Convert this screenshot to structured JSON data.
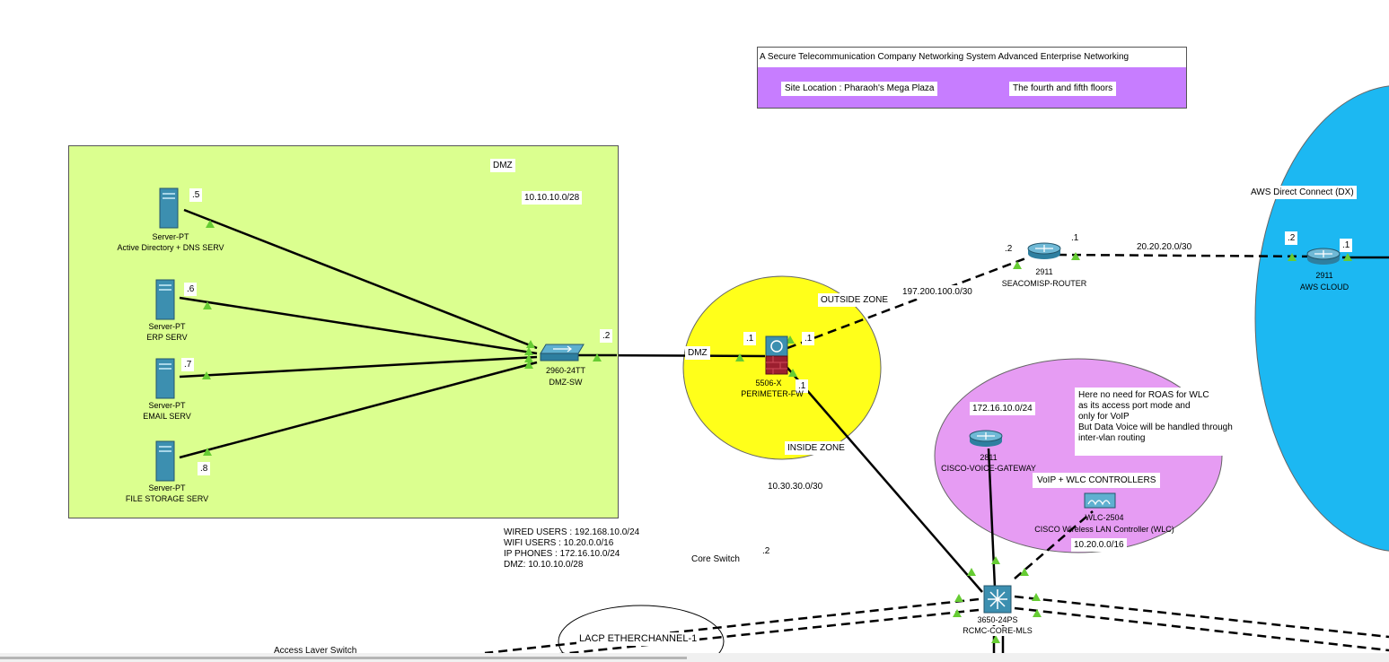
{
  "title": {
    "main": "A Secure Telecommunication Company Networking System  Advanced Enterprise Networking",
    "site_location": "Site Location : Pharaoh's Mega Plaza",
    "floors": "The fourth and fifth floors"
  },
  "dmz_zone": {
    "label": "DMZ",
    "subnet": "10.10.10.0/28",
    "servers": [
      {
        "model": "Server-PT",
        "name": "Active Directory + DNS SERV",
        "ip": ".5"
      },
      {
        "model": "Server-PT",
        "name": "ERP SERV",
        "ip": ".6"
      },
      {
        "model": "Server-PT",
        "name": "EMAIL SERV",
        "ip": ".7"
      },
      {
        "model": "Server-PT",
        "name": "FILE STORAGE SERV",
        "ip": ".8"
      }
    ],
    "switch": {
      "model": "2960-24TT",
      "name": "DMZ-SW",
      "ip": ".2"
    }
  },
  "firewall": {
    "model": "5506-X",
    "name": "PERIMETER-FW",
    "outside_zone": "OUTSIDE ZONE",
    "inside_zone": "INSIDE ZONE",
    "dmz_link_label": "DMZ",
    "ip_dmz": ".1",
    "ip_outside": ".1",
    "ip_inside": ".1"
  },
  "isp": {
    "model": "2911",
    "name": "SEACOMISP-ROUTER",
    "link_subnet": "197.200.100.0/30",
    "ip_left": ".2",
    "ip_right": ".1",
    "uplink_subnet": "20.20.20.0/30"
  },
  "aws": {
    "label": "AWS Direct Connect (DX)",
    "model": "2911",
    "name": "AWS CLOUD",
    "ip_left": ".2",
    "ip_right": ".1"
  },
  "voip_zone": {
    "gateway_subnet": "172.16.10.0/24",
    "gateway_model": "2811",
    "gateway_name": "CISCO-VOICE-GATEWAY",
    "controllers_label": "VoIP + WLC CONTROLLERS",
    "wlc_model": "WLC-2504",
    "wlc_name": "CISCO Wireless LAN Controller (WLC)",
    "wlc_subnet": "10.20.0.0/16",
    "note": "Here no need for ROAS for WLC\n as its access port mode and\nonly for VoIP\nBut Data Voice will be handled through\n inter-vlan routing"
  },
  "core": {
    "inside_subnet": "10.30.30.0/30",
    "core_switch_label": "Core Switch",
    "core_ip": ".2",
    "model": "3650-24PS",
    "name": "RCMC-CORE-MLS",
    "lacp_label": "LACP ETHERCHANNEL-1",
    "access_label": "Access Layer Switch"
  },
  "summary": {
    "lines": [
      "WIRED USERS : 192.168.10.0/24",
      "WIFI USERS : 10.20.0.0/16",
      "IP PHONES : 172.16.10.0/24",
      "DMZ: 10.10.10.0/28"
    ]
  },
  "colors": {
    "dmz_fill": "#dbff8f",
    "outside_zone_fill": "#ffff1a",
    "voip_zone_fill": "#e69cf3",
    "aws_fill": "#1cb8f2",
    "title_fill": "#c77dff",
    "link_indicator": "#66cc33"
  }
}
